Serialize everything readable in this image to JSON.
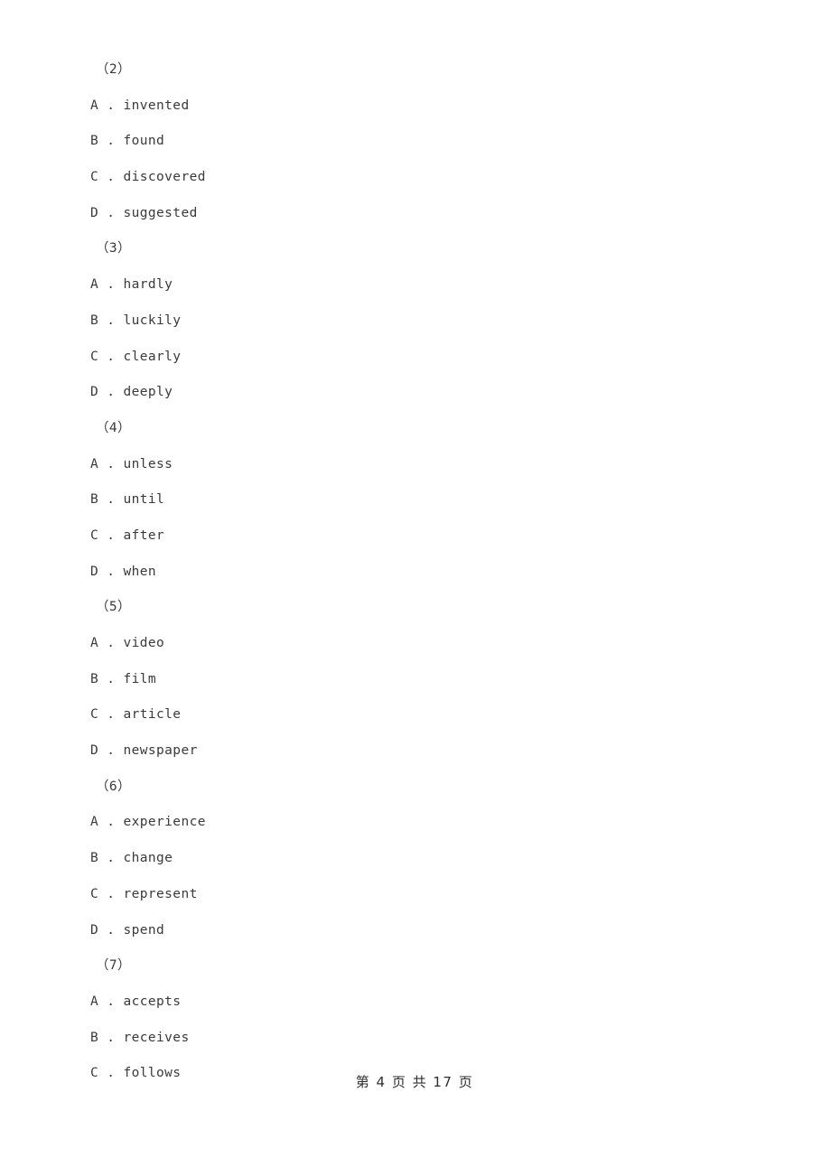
{
  "page": {
    "background_color": "#ffffff",
    "text_color": "#3a3a3a"
  },
  "document": {
    "groups": [
      {
        "header": "（2）",
        "options": [
          {
            "letter": "A",
            "sep": " . ",
            "text": "invented"
          },
          {
            "letter": "B",
            "sep": " . ",
            "text": "found"
          },
          {
            "letter": "C",
            "sep": " . ",
            "text": "discovered"
          },
          {
            "letter": "D",
            "sep": " . ",
            "text": "suggested"
          }
        ]
      },
      {
        "header": "（3）",
        "options": [
          {
            "letter": "A",
            "sep": " . ",
            "text": "hardly"
          },
          {
            "letter": "B",
            "sep": " . ",
            "text": "luckily"
          },
          {
            "letter": "C",
            "sep": " . ",
            "text": "clearly"
          },
          {
            "letter": "D",
            "sep": " . ",
            "text": "deeply"
          }
        ]
      },
      {
        "header": "（4）",
        "options": [
          {
            "letter": "A",
            "sep": " . ",
            "text": "unless"
          },
          {
            "letter": "B",
            "sep": " . ",
            "text": "until"
          },
          {
            "letter": "C",
            "sep": " . ",
            "text": "after"
          },
          {
            "letter": "D",
            "sep": " . ",
            "text": "when"
          }
        ]
      },
      {
        "header": "（5）",
        "options": [
          {
            "letter": "A",
            "sep": " . ",
            "text": "video"
          },
          {
            "letter": "B",
            "sep": " . ",
            "text": "film"
          },
          {
            "letter": "C",
            "sep": " . ",
            "text": "article"
          },
          {
            "letter": "D",
            "sep": " . ",
            "text": "newspaper"
          }
        ]
      },
      {
        "header": "（6）",
        "options": [
          {
            "letter": "A",
            "sep": " . ",
            "text": "experience"
          },
          {
            "letter": "B",
            "sep": " . ",
            "text": "change"
          },
          {
            "letter": "C",
            "sep": " . ",
            "text": "represent"
          },
          {
            "letter": "D",
            "sep": " . ",
            "text": "spend"
          }
        ]
      },
      {
        "header": "（7）",
        "options": [
          {
            "letter": "A",
            "sep": " . ",
            "text": "accepts"
          },
          {
            "letter": "B",
            "sep": " . ",
            "text": "receives"
          },
          {
            "letter": "C",
            "sep": " . ",
            "text": "follows"
          }
        ]
      }
    ]
  },
  "footer": {
    "text": "第 4 页 共 17 页",
    "current_page": "4",
    "total_pages": "17"
  }
}
